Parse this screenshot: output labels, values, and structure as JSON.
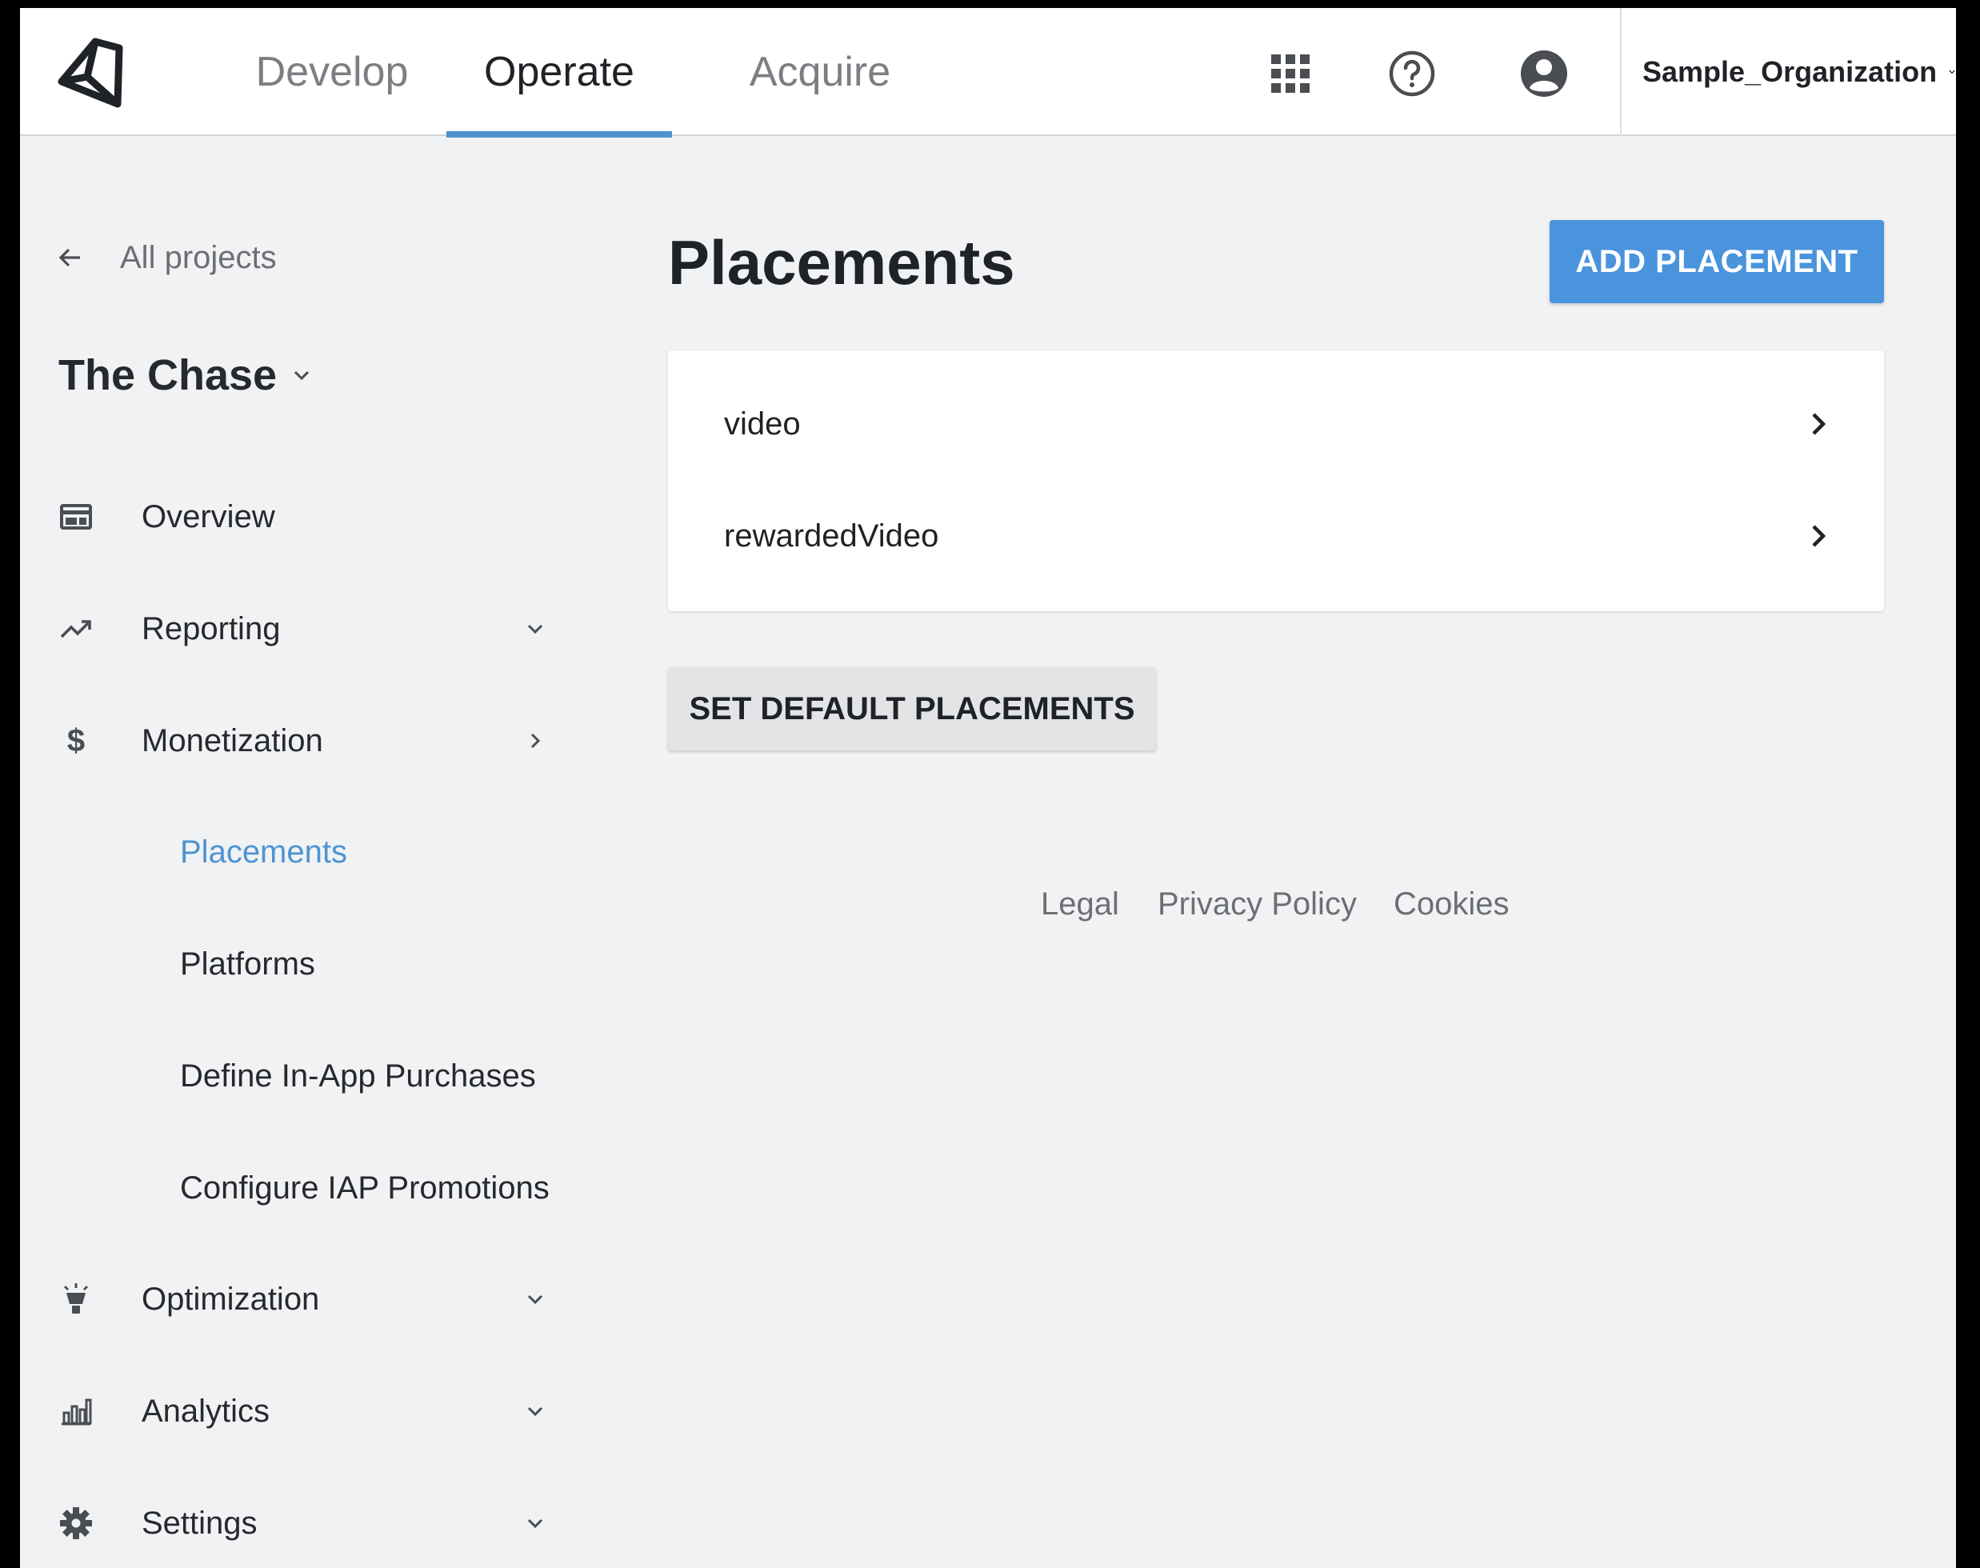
{
  "header": {
    "tabs": [
      {
        "label": "Develop",
        "active": false
      },
      {
        "label": "Operate",
        "active": true
      },
      {
        "label": "Acquire",
        "active": false
      }
    ],
    "icons": [
      "unity-logo-icon",
      "apps-grid-icon",
      "help-icon",
      "account-icon"
    ],
    "organization": "Sample_Organization",
    "accent_color": "#4e93d0"
  },
  "sidebar": {
    "back_label": "All projects",
    "project_name": "The Chase",
    "items": [
      {
        "label": "Overview",
        "icon": "overview-icon"
      },
      {
        "label": "Reporting",
        "icon": "trending-up-icon",
        "state": "collapsed"
      },
      {
        "label": "Monetization",
        "icon": "dollar-icon",
        "state": "expanded"
      },
      {
        "label": "Optimization",
        "icon": "lightbulb-icon",
        "state": "collapsed"
      },
      {
        "label": "Analytics",
        "icon": "bar-chart-icon",
        "state": "collapsed"
      },
      {
        "label": "Settings",
        "icon": "gear-icon",
        "state": "collapsed"
      }
    ],
    "subitems": [
      {
        "label": "Placements",
        "active": true
      },
      {
        "label": "Platforms",
        "active": false
      },
      {
        "label": "Define In-App Purchases",
        "active": false
      },
      {
        "label": "Configure IAP Promotions",
        "active": false
      }
    ]
  },
  "main": {
    "title": "Placements",
    "add_button": "ADD PLACEMENT",
    "add_button_color": "#4a94dd",
    "placements": [
      {
        "name": "video"
      },
      {
        "name": "rewardedVideo"
      }
    ],
    "default_button": "SET DEFAULT PLACEMENTS"
  },
  "footer": {
    "links": [
      "Legal",
      "Privacy Policy",
      "Cookies"
    ]
  }
}
